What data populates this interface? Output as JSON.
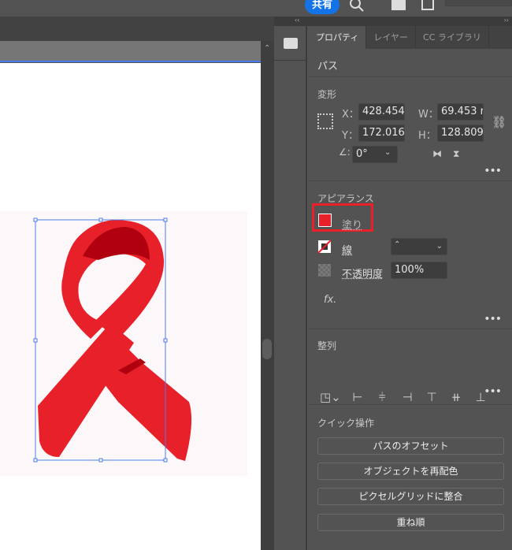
{
  "header": {
    "share_label": "共有"
  },
  "panel": {
    "tabs": [
      "プロパティ",
      "レイヤー",
      "CC ライブラリ"
    ],
    "object_type": "パス",
    "transform": {
      "title": "変形",
      "x_label": "X：",
      "x": "428.454",
      "y_label": "Y：",
      "y": "172.016",
      "w_label": "W：",
      "w": "69.453 r",
      "h_label": "H：",
      "h": "128.809",
      "angle": "0°"
    },
    "appearance": {
      "title": "アピアランス",
      "fill_label": "塗り",
      "stroke_label": "線",
      "opacity_label": "不透明度",
      "opacity": "100%",
      "fx_label": "fx.",
      "fill_color": "#e8202a"
    },
    "align": {
      "title": "整列"
    },
    "quick": {
      "title": "クイック操作",
      "buttons": [
        "パスのオフセット",
        "オブジェクトを再配色",
        "ピクセルグリッドに整合",
        "重ね順"
      ]
    }
  },
  "colors": {
    "highlight": "#e8202a",
    "ribbon": "#e8202a",
    "ribbon_dark": "#b00010",
    "selection": "#4a7bea"
  }
}
